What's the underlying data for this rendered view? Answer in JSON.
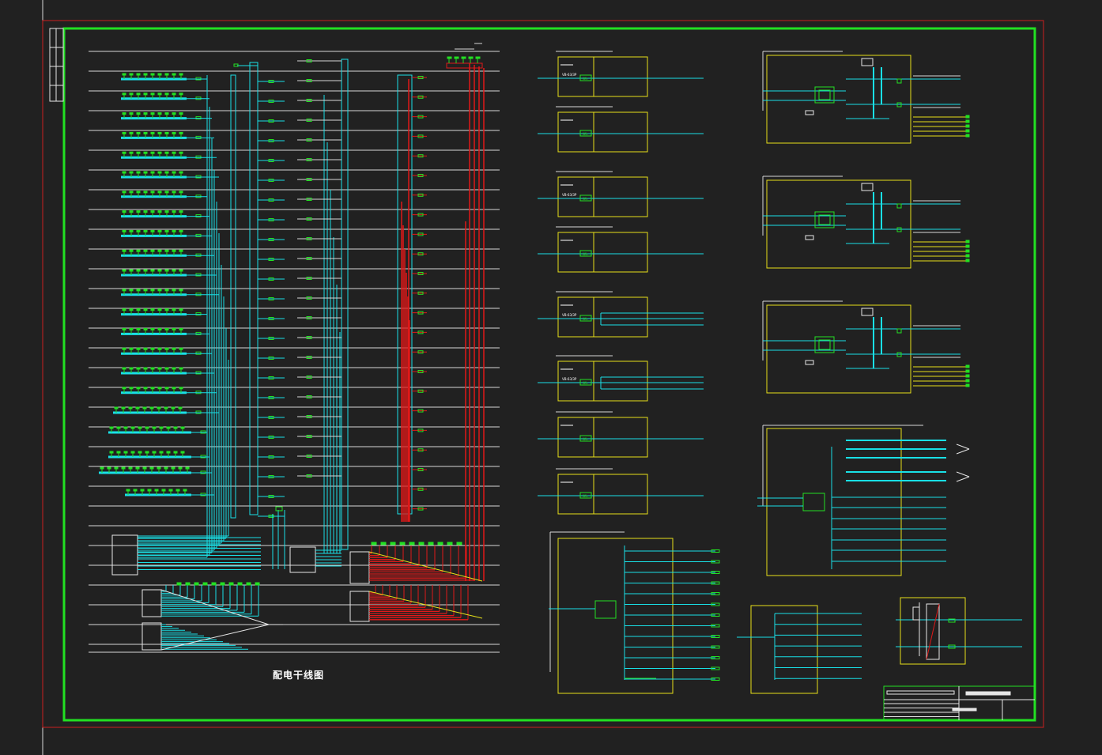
{
  "drawing": {
    "title_caption": "配电干线图",
    "meter_label": "Wh",
    "breaker_code": "VB-63/3P",
    "colors": {
      "background": "#212121",
      "outer_frame": "#cc1f1f",
      "inner_frame": "#22e022",
      "feeder": "#19e0e6",
      "fire_feeder": "#e01919",
      "panel_box": "#e6e019",
      "breaker": "#22e022",
      "text": "#ffffff"
    }
  }
}
